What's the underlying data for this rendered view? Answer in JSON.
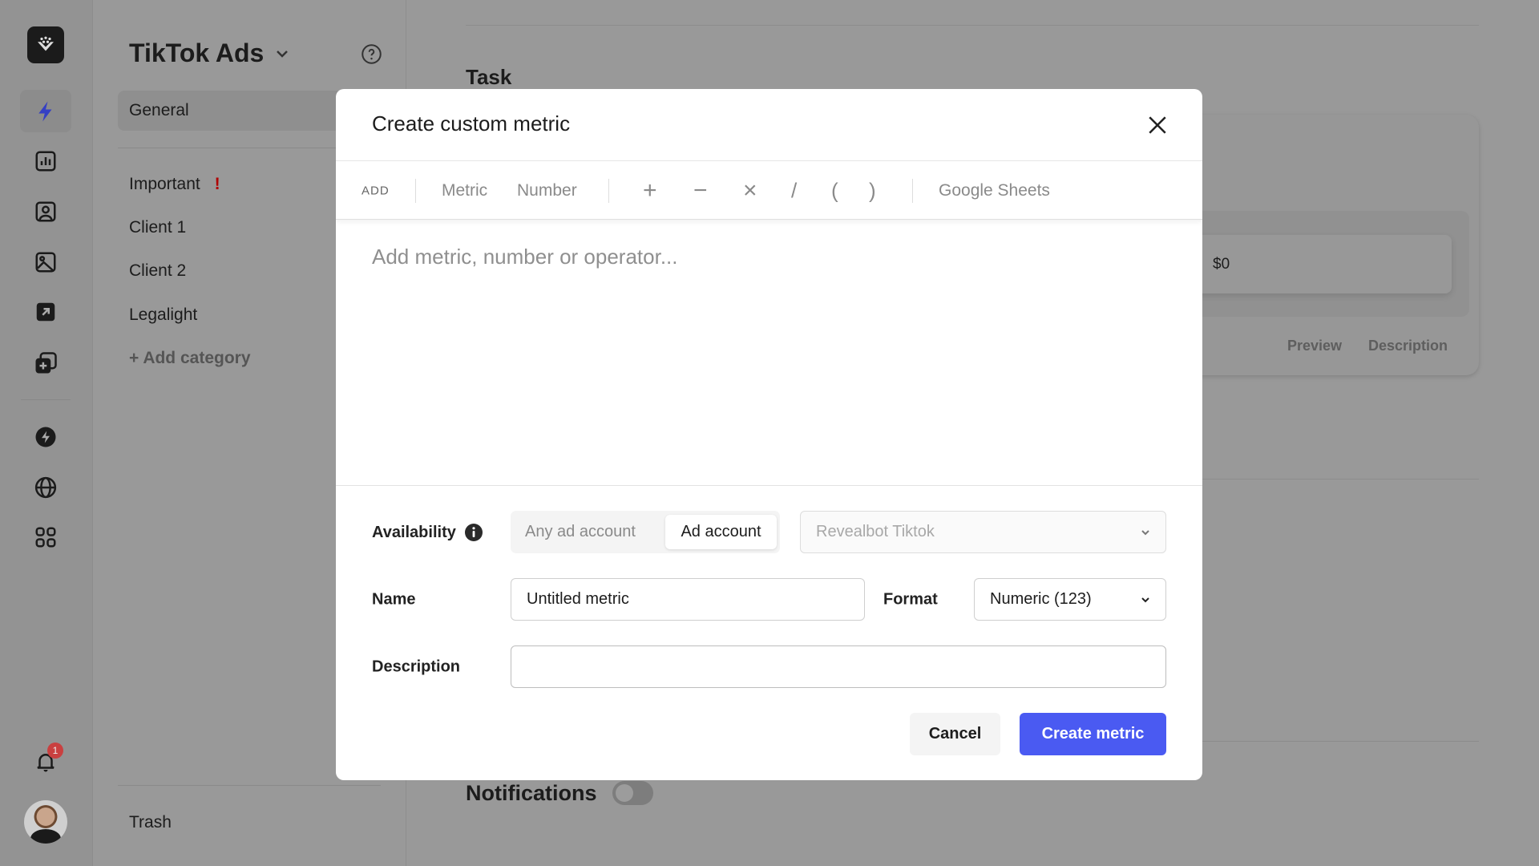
{
  "sidebar": {
    "workspace_title": "TikTok Ads",
    "items": [
      {
        "label": "General"
      },
      {
        "label": "Important",
        "badge": "!"
      },
      {
        "label": "Client 1"
      },
      {
        "label": "Client 2"
      },
      {
        "label": "Legalight"
      }
    ],
    "add_category": "+ Add category",
    "trash": "Trash"
  },
  "rail": {
    "notification_count": "1",
    "active": "bolt",
    "icons": [
      "logo",
      "bolt-icon",
      "chart-icon",
      "contact-icon",
      "image-icon",
      "external-link-icon",
      "add-copy-icon",
      "automation-icon",
      "globe-icon",
      "apps-icon",
      "bell-icon",
      "avatar"
    ]
  },
  "main": {
    "task_heading": "Task",
    "card_value": "$0",
    "card_tabs": [
      "Preview",
      "Description"
    ],
    "notifications_label": "Notifications",
    "notifications_enabled": false
  },
  "modal": {
    "title": "Create custom metric",
    "toolbar": {
      "add": "ADD",
      "metric": "Metric",
      "number": "Number",
      "ops": [
        "+",
        "−",
        "×",
        "/",
        "(",
        ")"
      ],
      "google_sheets": "Google Sheets"
    },
    "formula_placeholder": "Add metric, number or operator...",
    "availability": {
      "label": "Availability",
      "options": [
        "Any ad account",
        "Ad account"
      ],
      "selected": "Ad account",
      "account_select": "Revealbot Tiktok"
    },
    "name": {
      "label": "Name",
      "value": "Untitled metric"
    },
    "format": {
      "label": "Format",
      "value": "Numeric (123)"
    },
    "description": {
      "label": "Description",
      "value": ""
    },
    "cancel": "Cancel",
    "create": "Create metric"
  },
  "colors": {
    "accent": "#4a5af2",
    "active_icon": "#3540c4",
    "badge": "#d53b3b",
    "important": "#c00000"
  }
}
